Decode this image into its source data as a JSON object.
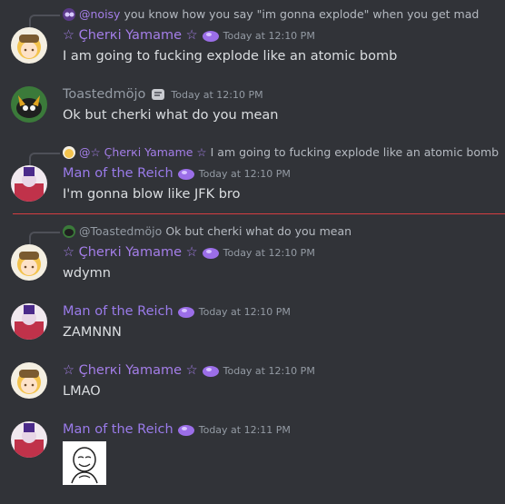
{
  "messages": [
    {
      "reply": {
        "name": "@noisy",
        "text": "you know how you say \"im gonna explode\" when you get mad"
      },
      "author": "☆ Çherкi Yamame ☆",
      "timestamp": "Today at 12:10 PM",
      "content": "I am going to fucking explode like an atomic bomb"
    },
    {
      "author": "Toastedmöjo",
      "timestamp": "Today at 12:10 PM",
      "content": "Ok but cherki what do you mean"
    },
    {
      "reply": {
        "name": "@☆ Çherкi Yamame ☆",
        "text": "I am going to fucking explode like an atomic bomb"
      },
      "author": "Man of the Reich",
      "timestamp": "Today at 12:10 PM",
      "content": "I'm gonna blow like JFK bro"
    },
    {
      "reply": {
        "name": "@Toastedmöjo",
        "text": "Ok but cherki what do you mean"
      },
      "author": "☆ Çherкi Yamame ☆",
      "timestamp": "Today at 12:10 PM",
      "content": "wdymn"
    },
    {
      "author": "Man of the Reich",
      "timestamp": "Today at 12:10 PM",
      "content": "ZAMNNN"
    },
    {
      "author": "☆ Çherкi Yamame ☆",
      "timestamp": "Today at 12:10 PM",
      "content": "LMAO"
    },
    {
      "author": "Man of the Reich",
      "timestamp": "Today at 12:11 PM",
      "content": ""
    }
  ],
  "colors": {
    "background": "#313338",
    "cherki_name": "#a47ee8",
    "reich_name": "#9a7bea",
    "toasted_name": "#949ba4",
    "new_divider": "#f23f43"
  },
  "icons": {
    "role_badge": "purple-blob-icon",
    "toasted_badge": "grey-badge-icon",
    "attachment": "meme-face-image"
  }
}
